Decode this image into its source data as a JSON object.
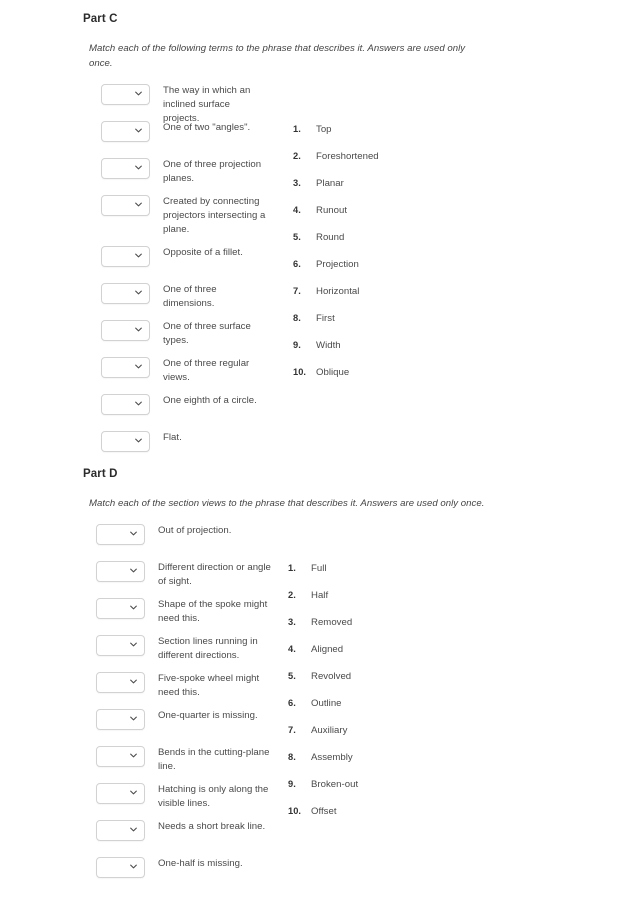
{
  "parts": [
    {
      "id": "part-c",
      "title": "Part C",
      "instructions": "Match each of the following terms to the phrase that describes it. Answers are used only once.",
      "prompts": [
        {
          "text": "The way in which an inclined surface projects.",
          "lines": 2,
          "selected": ""
        },
        {
          "text": "One of two \"angles\".",
          "lines": 1,
          "selected": ""
        },
        {
          "text": "One of three projection planes.",
          "lines": 2,
          "selected": ""
        },
        {
          "text": "Created by connecting projectors intersecting a plane.",
          "lines": 3,
          "selected": ""
        },
        {
          "text": "Opposite of a fillet.",
          "lines": 1,
          "selected": ""
        },
        {
          "text": "One of three dimensions.",
          "lines": 1,
          "selected": ""
        },
        {
          "text": "One of three surface types.",
          "lines": 2,
          "selected": ""
        },
        {
          "text": "One of three regular views.",
          "lines": 2,
          "selected": ""
        },
        {
          "text": "One eighth of a circle.",
          "lines": 1,
          "selected": ""
        },
        {
          "text": "Flat.",
          "lines": 1,
          "selected": ""
        }
      ],
      "answers": [
        {
          "num": "1.",
          "label": "Top"
        },
        {
          "num": "2.",
          "label": "Foreshortened"
        },
        {
          "num": "3.",
          "label": "Planar"
        },
        {
          "num": "4.",
          "label": "Runout"
        },
        {
          "num": "5.",
          "label": "Round"
        },
        {
          "num": "6.",
          "label": "Projection"
        },
        {
          "num": "7.",
          "label": "Horizontal"
        },
        {
          "num": "8.",
          "label": "First"
        },
        {
          "num": "9.",
          "label": "Width"
        },
        {
          "num": "10.",
          "label": "Oblique"
        }
      ]
    },
    {
      "id": "part-d",
      "title": "Part D",
      "instructions": "Match each of the section views to the phrase that describes it. Answers are used only once.",
      "prompts": [
        {
          "text": "Out of projection.",
          "lines": 1,
          "selected": ""
        },
        {
          "text": "Different direction or angle of sight.",
          "lines": 2,
          "selected": ""
        },
        {
          "text": "Shape of the spoke might need this.",
          "lines": 2,
          "selected": ""
        },
        {
          "text": "Section lines running in different directions.",
          "lines": 2,
          "selected": ""
        },
        {
          "text": "Five-spoke wheel might need this.",
          "lines": 2,
          "selected": ""
        },
        {
          "text": "One-quarter is missing.",
          "lines": 1,
          "selected": ""
        },
        {
          "text": "Bends in the cutting-plane line.",
          "lines": 2,
          "selected": ""
        },
        {
          "text": "Hatching is only along the visible lines.",
          "lines": 2,
          "selected": ""
        },
        {
          "text": "Needs a short break line.",
          "lines": 1,
          "selected": ""
        },
        {
          "text": "One-half is missing.",
          "lines": 1,
          "selected": ""
        }
      ],
      "answers": [
        {
          "num": "1.",
          "label": "Full"
        },
        {
          "num": "2.",
          "label": "Half"
        },
        {
          "num": "3.",
          "label": "Removed"
        },
        {
          "num": "4.",
          "label": "Aligned"
        },
        {
          "num": "5.",
          "label": "Revolved"
        },
        {
          "num": "6.",
          "label": "Outline"
        },
        {
          "num": "7.",
          "label": "Auxiliary"
        },
        {
          "num": "8.",
          "label": "Assembly"
        },
        {
          "num": "9.",
          "label": "Broken-out"
        },
        {
          "num": "10.",
          "label": "Offset"
        }
      ]
    }
  ],
  "icons": {
    "chevron_down": "chevron-down-icon"
  },
  "colors": {
    "page_background": "#ffffff",
    "title_text": "#2b2b2b",
    "body_text": "#4a4a4a",
    "dropdown_border": "#d2d2d2",
    "dropdown_background": "#ffffff"
  }
}
